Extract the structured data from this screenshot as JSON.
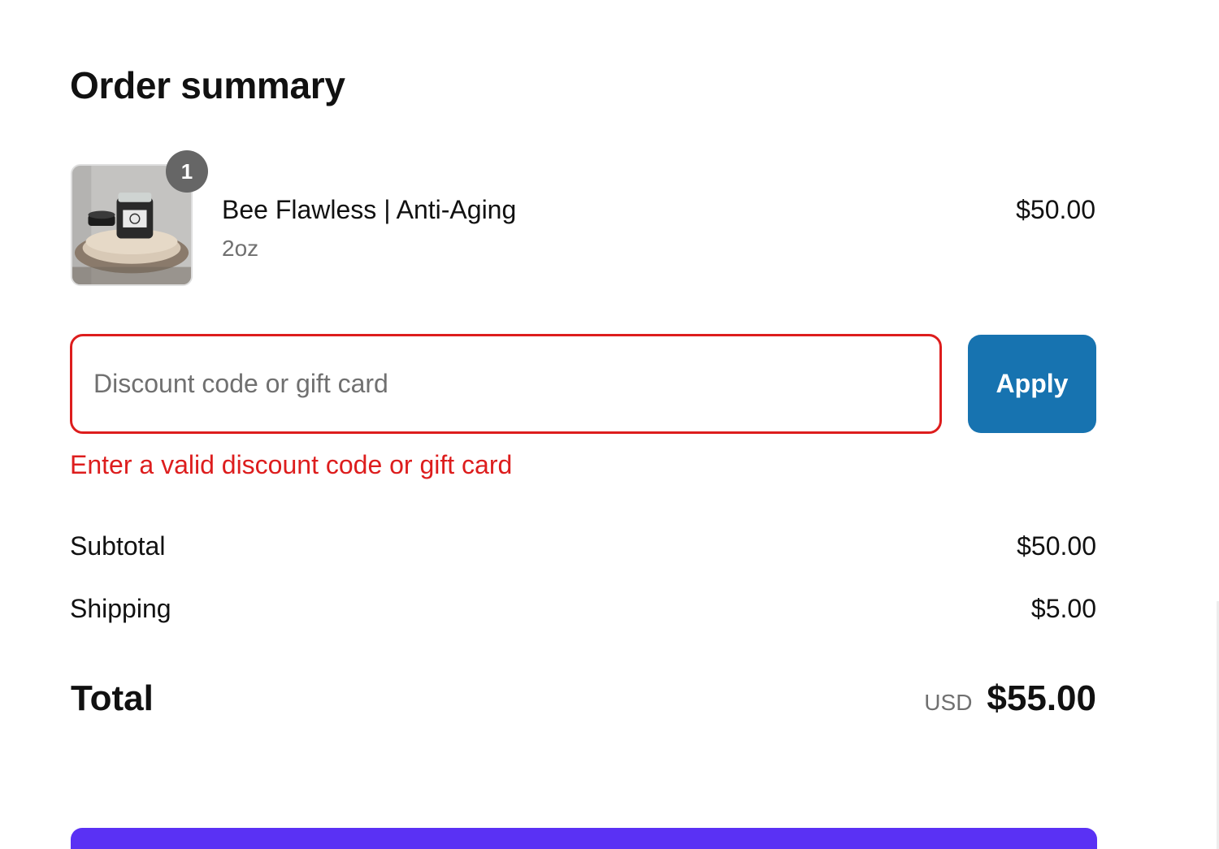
{
  "order_summary": {
    "title": "Order summary",
    "item": {
      "quantity": "1",
      "name": "Bee Flawless | Anti-Aging",
      "variant": "2oz",
      "price": "$50.00",
      "image_icon": "product-jar-photo"
    },
    "discount": {
      "placeholder": "Discount code or gift card",
      "value": "",
      "apply_label": "Apply",
      "error": "Enter a valid discount code or gift card"
    },
    "subtotal": {
      "label": "Subtotal",
      "value": "$50.00"
    },
    "shipping": {
      "label": "Shipping",
      "value": "$5.00"
    },
    "total": {
      "label": "Total",
      "currency": "USD",
      "value": "$55.00"
    }
  },
  "colors": {
    "accent_blue": "#1773b0",
    "error_red": "#dd1d1d",
    "pay_purple": "#5a31f4",
    "muted_text": "#707070"
  }
}
